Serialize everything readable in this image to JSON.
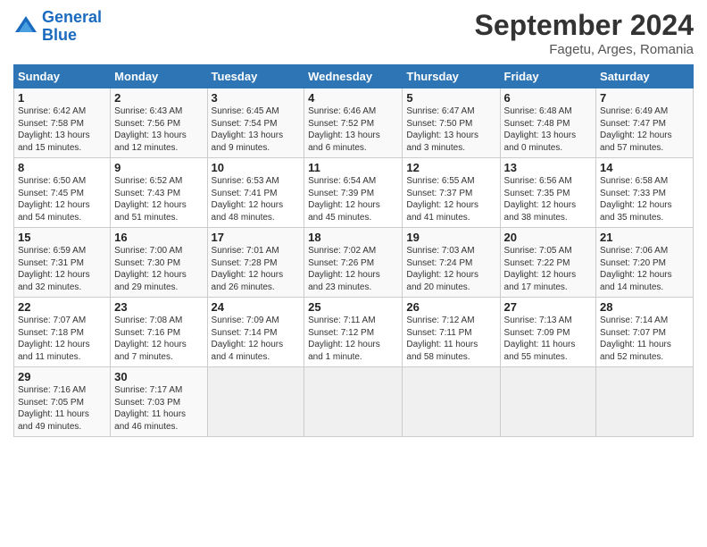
{
  "logo": {
    "line1": "General",
    "line2": "Blue"
  },
  "title": "September 2024",
  "subtitle": "Fagetu, Arges, Romania",
  "header_row": [
    "Sunday",
    "Monday",
    "Tuesday",
    "Wednesday",
    "Thursday",
    "Friday",
    "Saturday"
  ],
  "weeks": [
    [
      {
        "day": "1",
        "info": "Sunrise: 6:42 AM\nSunset: 7:58 PM\nDaylight: 13 hours\nand 15 minutes."
      },
      {
        "day": "2",
        "info": "Sunrise: 6:43 AM\nSunset: 7:56 PM\nDaylight: 13 hours\nand 12 minutes."
      },
      {
        "day": "3",
        "info": "Sunrise: 6:45 AM\nSunset: 7:54 PM\nDaylight: 13 hours\nand 9 minutes."
      },
      {
        "day": "4",
        "info": "Sunrise: 6:46 AM\nSunset: 7:52 PM\nDaylight: 13 hours\nand 6 minutes."
      },
      {
        "day": "5",
        "info": "Sunrise: 6:47 AM\nSunset: 7:50 PM\nDaylight: 13 hours\nand 3 minutes."
      },
      {
        "day": "6",
        "info": "Sunrise: 6:48 AM\nSunset: 7:48 PM\nDaylight: 13 hours\nand 0 minutes."
      },
      {
        "day": "7",
        "info": "Sunrise: 6:49 AM\nSunset: 7:47 PM\nDaylight: 12 hours\nand 57 minutes."
      }
    ],
    [
      {
        "day": "8",
        "info": "Sunrise: 6:50 AM\nSunset: 7:45 PM\nDaylight: 12 hours\nand 54 minutes."
      },
      {
        "day": "9",
        "info": "Sunrise: 6:52 AM\nSunset: 7:43 PM\nDaylight: 12 hours\nand 51 minutes."
      },
      {
        "day": "10",
        "info": "Sunrise: 6:53 AM\nSunset: 7:41 PM\nDaylight: 12 hours\nand 48 minutes."
      },
      {
        "day": "11",
        "info": "Sunrise: 6:54 AM\nSunset: 7:39 PM\nDaylight: 12 hours\nand 45 minutes."
      },
      {
        "day": "12",
        "info": "Sunrise: 6:55 AM\nSunset: 7:37 PM\nDaylight: 12 hours\nand 41 minutes."
      },
      {
        "day": "13",
        "info": "Sunrise: 6:56 AM\nSunset: 7:35 PM\nDaylight: 12 hours\nand 38 minutes."
      },
      {
        "day": "14",
        "info": "Sunrise: 6:58 AM\nSunset: 7:33 PM\nDaylight: 12 hours\nand 35 minutes."
      }
    ],
    [
      {
        "day": "15",
        "info": "Sunrise: 6:59 AM\nSunset: 7:31 PM\nDaylight: 12 hours\nand 32 minutes."
      },
      {
        "day": "16",
        "info": "Sunrise: 7:00 AM\nSunset: 7:30 PM\nDaylight: 12 hours\nand 29 minutes."
      },
      {
        "day": "17",
        "info": "Sunrise: 7:01 AM\nSunset: 7:28 PM\nDaylight: 12 hours\nand 26 minutes."
      },
      {
        "day": "18",
        "info": "Sunrise: 7:02 AM\nSunset: 7:26 PM\nDaylight: 12 hours\nand 23 minutes."
      },
      {
        "day": "19",
        "info": "Sunrise: 7:03 AM\nSunset: 7:24 PM\nDaylight: 12 hours\nand 20 minutes."
      },
      {
        "day": "20",
        "info": "Sunrise: 7:05 AM\nSunset: 7:22 PM\nDaylight: 12 hours\nand 17 minutes."
      },
      {
        "day": "21",
        "info": "Sunrise: 7:06 AM\nSunset: 7:20 PM\nDaylight: 12 hours\nand 14 minutes."
      }
    ],
    [
      {
        "day": "22",
        "info": "Sunrise: 7:07 AM\nSunset: 7:18 PM\nDaylight: 12 hours\nand 11 minutes."
      },
      {
        "day": "23",
        "info": "Sunrise: 7:08 AM\nSunset: 7:16 PM\nDaylight: 12 hours\nand 7 minutes."
      },
      {
        "day": "24",
        "info": "Sunrise: 7:09 AM\nSunset: 7:14 PM\nDaylight: 12 hours\nand 4 minutes."
      },
      {
        "day": "25",
        "info": "Sunrise: 7:11 AM\nSunset: 7:12 PM\nDaylight: 12 hours\nand 1 minute."
      },
      {
        "day": "26",
        "info": "Sunrise: 7:12 AM\nSunset: 7:11 PM\nDaylight: 11 hours\nand 58 minutes."
      },
      {
        "day": "27",
        "info": "Sunrise: 7:13 AM\nSunset: 7:09 PM\nDaylight: 11 hours\nand 55 minutes."
      },
      {
        "day": "28",
        "info": "Sunrise: 7:14 AM\nSunset: 7:07 PM\nDaylight: 11 hours\nand 52 minutes."
      }
    ],
    [
      {
        "day": "29",
        "info": "Sunrise: 7:16 AM\nSunset: 7:05 PM\nDaylight: 11 hours\nand 49 minutes."
      },
      {
        "day": "30",
        "info": "Sunrise: 7:17 AM\nSunset: 7:03 PM\nDaylight: 11 hours\nand 46 minutes."
      },
      {
        "day": "",
        "info": ""
      },
      {
        "day": "",
        "info": ""
      },
      {
        "day": "",
        "info": ""
      },
      {
        "day": "",
        "info": ""
      },
      {
        "day": "",
        "info": ""
      }
    ]
  ]
}
